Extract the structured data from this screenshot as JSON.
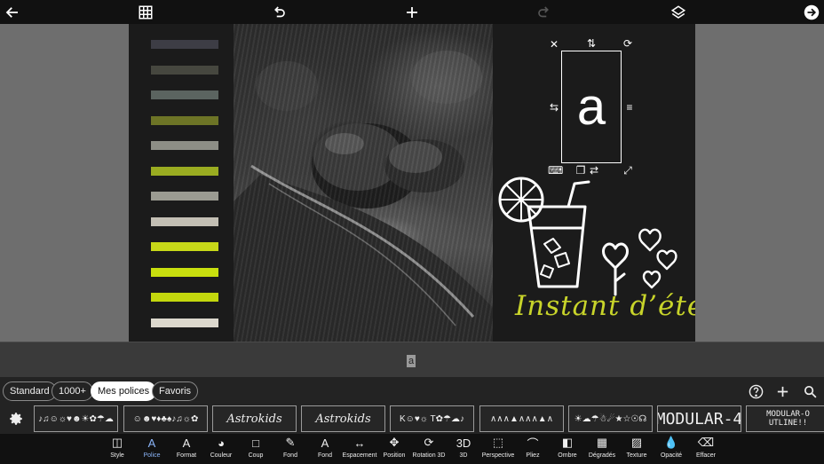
{
  "topbar": {
    "icons": [
      "back-arrow-icon",
      "grid-icon",
      "undo-icon",
      "add-icon",
      "redo-icon",
      "layers-icon",
      "forward-arrow-icon"
    ]
  },
  "canvas": {
    "swatch_colors": [
      "#3d3d45",
      "#46473f",
      "#5b6460",
      "#6d7426",
      "#8d8e86",
      "#9aac21",
      "#9b9b92",
      "#c3bfb4",
      "#c7d818",
      "#c8df0e",
      "#c3d70d",
      "#dcd8cd"
    ],
    "selected_letter": "a",
    "artwork_text": "Instant d’été",
    "accent": "#c8d42a"
  },
  "preview": {
    "letter": "a"
  },
  "font_filters": {
    "pills": [
      "Standard",
      "1000+",
      "Mes polices",
      "Favoris"
    ],
    "active": "Mes polices"
  },
  "font_tiles": [
    "♪♫☺☼♥☻☀✿☂☁",
    "☺☻♥♦♣♠♪♫☼✿",
    "Astrokids",
    "Astrokids",
    "K☺♥☼ T✿☂☁♪",
    "∧∧∧▲∧∧∧▲∧",
    "☀☁☂☃☄★☆☉☊",
    "MODULAR-4",
    "MODULAR-O UTLINE!!"
  ],
  "tools": [
    {
      "label": "Style",
      "glyph": "◫"
    },
    {
      "label": "Police",
      "glyph": "A"
    },
    {
      "label": "Format",
      "glyph": "A"
    },
    {
      "label": "Couleur",
      "glyph": "◕"
    },
    {
      "label": "Coup",
      "glyph": "□"
    },
    {
      "label": "Fond",
      "glyph": "✎"
    },
    {
      "label": "Fond",
      "glyph": "A"
    },
    {
      "label": "Espacement",
      "glyph": "↔"
    },
    {
      "label": "Position",
      "glyph": "✥"
    },
    {
      "label": "Rotation 3D",
      "glyph": "⟳"
    },
    {
      "label": "3D",
      "glyph": "3D"
    },
    {
      "label": "Perspective",
      "glyph": "⬚"
    },
    {
      "label": "Pliez",
      "glyph": "⌒"
    },
    {
      "label": "Ombre",
      "glyph": "◧"
    },
    {
      "label": "Dégradés",
      "glyph": "▦"
    },
    {
      "label": "Texture",
      "glyph": "▨"
    },
    {
      "label": "Opacité",
      "glyph": "💧"
    },
    {
      "label": "Effacer",
      "glyph": "⌫"
    }
  ],
  "active_tool": "Police"
}
